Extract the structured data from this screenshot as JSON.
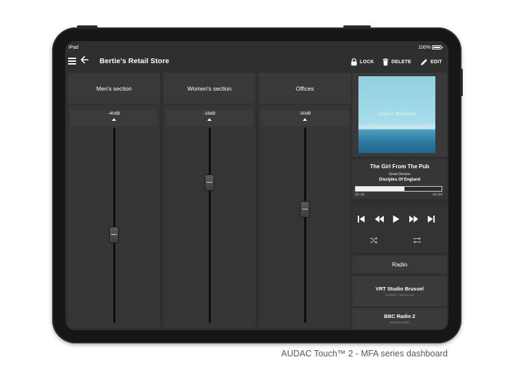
{
  "status_bar": {
    "device": "iPad",
    "battery": "100%"
  },
  "header": {
    "title": "Bertie's Retail Store",
    "actions": {
      "lock": "LOCK",
      "delete": "DELETE",
      "edit": "EDIT"
    }
  },
  "zones": [
    {
      "name": "Men's section",
      "level": "-40dB",
      "fader_fraction": 0.45
    },
    {
      "name": "Women's section",
      "level": "-18dB",
      "fader_fraction": 0.72
    },
    {
      "name": "Offices",
      "level": "-30dB",
      "fader_fraction": 0.58
    }
  ],
  "player": {
    "album_art_text": "GREAT DIVISION",
    "track_title": "The Girl From The Pub",
    "album": "Great Division",
    "artist": "Disciples Of England",
    "elapsed": "02:35",
    "total": "04:34",
    "progress_fraction": 0.566
  },
  "radio": {
    "header": "Radio",
    "stations": [
      {
        "name": "VRT Studio Brussel",
        "subtitle": "AVADLE - Oui ou non"
      },
      {
        "name": "BBC Radio 2",
        "subtitle": "Internet Radio"
      }
    ]
  },
  "caption": "AUDAC Touch™ 2 - MFA series dashboard",
  "colors": {
    "app_background": "#2f2f2f",
    "panel": "#353535",
    "accent_text": "#ffffff"
  }
}
